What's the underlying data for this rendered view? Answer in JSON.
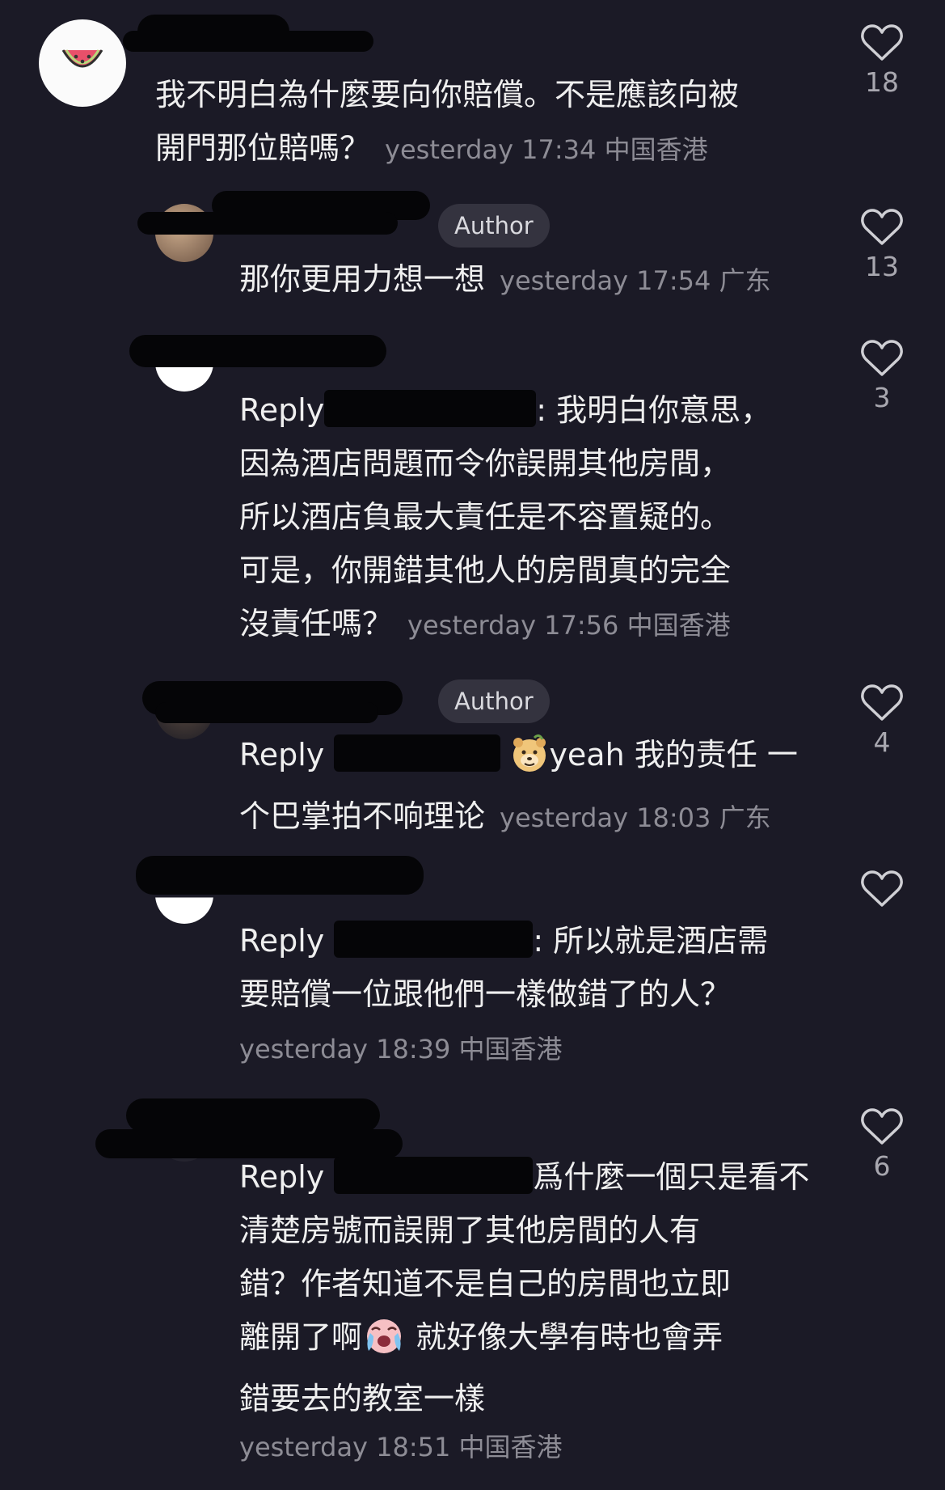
{
  "comments": [
    {
      "text": "我不明白為什麼要向你賠償。不是應該向被\n開門那位賠嗎？",
      "time": "yesterday 17:34",
      "location": "中国香港",
      "likes": "18"
    },
    {
      "badge": "Author",
      "text": "那你更用力想一想",
      "time": "yesterday 17:54",
      "location": "广东",
      "likes": "13"
    },
    {
      "reply_prefix": "Reply",
      "text_a": ": 我明白你意思，",
      "text_b": "因為酒店問題而令你誤開其他房間，\n所以酒店負最大責任是不容置疑的。\n可是，你開錯其他人的房間真的完全\n沒責任嗎？",
      "time": "yesterday 17:56",
      "location": "中国香港",
      "likes": "3"
    },
    {
      "badge": "Author",
      "reply_prefix": "Reply",
      "text_a": "yeah 我的责任 一",
      "text_b": "个巴掌拍不响理论",
      "time": "yesterday 18:03",
      "location": "广东",
      "likes": "4"
    },
    {
      "reply_prefix": "Reply",
      "text_a": ": 所以就是酒店需",
      "text_b": "要賠償一位跟他們一樣做錯了的人？",
      "time": "yesterday 18:39",
      "location": "中国香港",
      "likes": ""
    },
    {
      "reply_prefix": "Reply",
      "text_a": "爲什麼一個只是看不",
      "text_b": "清楚房號而誤開了其他房間的人有\n錯？作者知道不是自己的房間也立即",
      "text_c": "離開了啊",
      "text_d": " 就好像大學有時也會弄",
      "text_e": "錯要去的教室一樣",
      "time": "yesterday 18:51",
      "location": "中国香港",
      "likes": "6"
    }
  ],
  "icons": {
    "avatar": "watermelon-icon",
    "like": "heart-outline-icon",
    "emoji_1": "smiling-bear-emoji",
    "emoji_2": "crying-face-emoji"
  },
  "colors": {
    "background": "#1b1a26",
    "text": "#efefef",
    "meta": "#8d8c95",
    "badge_bg": "#34333f"
  }
}
